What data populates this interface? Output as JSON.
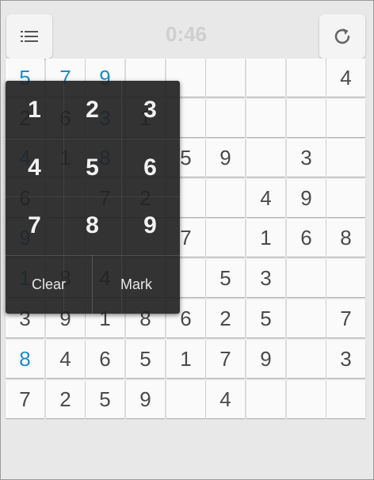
{
  "toolbar": {
    "menu_icon": "list-menu-icon",
    "timer": "0:46",
    "restart_icon": "refresh-icon"
  },
  "board": {
    "rows": [
      [
        {
          "v": "5",
          "g": true
        },
        {
          "v": "7",
          "g": true
        },
        {
          "v": "9",
          "g": true
        },
        {
          "v": "",
          "g": false
        },
        {
          "v": "",
          "g": false
        },
        {
          "v": "",
          "g": false
        },
        {
          "v": "",
          "g": false
        },
        {
          "v": "",
          "g": false
        },
        {
          "v": "4",
          "g": false
        }
      ],
      [
        {
          "v": "2",
          "g": false
        },
        {
          "v": "6",
          "g": false
        },
        {
          "v": "3",
          "g": true
        },
        {
          "v": "1",
          "g": false
        },
        {
          "v": "",
          "g": false
        },
        {
          "v": "",
          "g": false
        },
        {
          "v": "",
          "g": false
        },
        {
          "v": "",
          "g": false
        },
        {
          "v": "",
          "g": false
        }
      ],
      [
        {
          "v": "4",
          "g": true
        },
        {
          "v": "1",
          "g": false
        },
        {
          "v": "8",
          "g": true
        },
        {
          "v": "",
          "g": false
        },
        {
          "v": "5",
          "g": false
        },
        {
          "v": "9",
          "g": false
        },
        {
          "v": "",
          "g": false
        },
        {
          "v": "3",
          "g": false
        },
        {
          "v": "",
          "g": false
        }
      ],
      [
        {
          "v": "6",
          "g": false
        },
        {
          "v": "",
          "g": false
        },
        {
          "v": "7",
          "g": false
        },
        {
          "v": "2",
          "g": false
        },
        {
          "v": "",
          "g": false
        },
        {
          "v": "",
          "g": false
        },
        {
          "v": "4",
          "g": false
        },
        {
          "v": "9",
          "g": false
        },
        {
          "v": "",
          "g": false
        }
      ],
      [
        {
          "v": "9",
          "g": true
        },
        {
          "v": "",
          "g": false
        },
        {
          "v": "",
          "g": false
        },
        {
          "v": "",
          "g": false
        },
        {
          "v": "7",
          "g": false
        },
        {
          "v": "",
          "g": false
        },
        {
          "v": "1",
          "g": false
        },
        {
          "v": "6",
          "g": false
        },
        {
          "v": "8",
          "g": false
        }
      ],
      [
        {
          "v": "1",
          "g": true
        },
        {
          "v": "8",
          "g": false
        },
        {
          "v": "4",
          "g": false
        },
        {
          "v": "",
          "g": false
        },
        {
          "v": "",
          "g": false
        },
        {
          "v": "5",
          "g": false
        },
        {
          "v": "3",
          "g": false
        },
        {
          "v": "",
          "g": false
        },
        {
          "v": "",
          "g": false
        }
      ],
      [
        {
          "v": "3",
          "g": false
        },
        {
          "v": "9",
          "g": false
        },
        {
          "v": "1",
          "g": false
        },
        {
          "v": "8",
          "g": false
        },
        {
          "v": "6",
          "g": false
        },
        {
          "v": "2",
          "g": false
        },
        {
          "v": "5",
          "g": false
        },
        {
          "v": "",
          "g": false
        },
        {
          "v": "7",
          "g": false
        }
      ],
      [
        {
          "v": "8",
          "g": true
        },
        {
          "v": "4",
          "g": false
        },
        {
          "v": "6",
          "g": false
        },
        {
          "v": "5",
          "g": false
        },
        {
          "v": "1",
          "g": false
        },
        {
          "v": "7",
          "g": false
        },
        {
          "v": "9",
          "g": false
        },
        {
          "v": "",
          "g": false
        },
        {
          "v": "3",
          "g": false
        }
      ],
      [
        {
          "v": "7",
          "g": false
        },
        {
          "v": "2",
          "g": false
        },
        {
          "v": "5",
          "g": false
        },
        {
          "v": "9",
          "g": false
        },
        {
          "v": "",
          "g": false
        },
        {
          "v": "4",
          "g": false
        },
        {
          "v": "",
          "g": false
        },
        {
          "v": "",
          "g": false
        },
        {
          "v": "",
          "g": false
        }
      ]
    ],
    "given_color": "#1e8bc8",
    "entered_color": "#4a4a4a"
  },
  "number_pad": {
    "keys": [
      "1",
      "2",
      "3",
      "4",
      "5",
      "6",
      "7",
      "8",
      "9"
    ],
    "clear_label": "Clear",
    "mark_label": "Mark"
  }
}
